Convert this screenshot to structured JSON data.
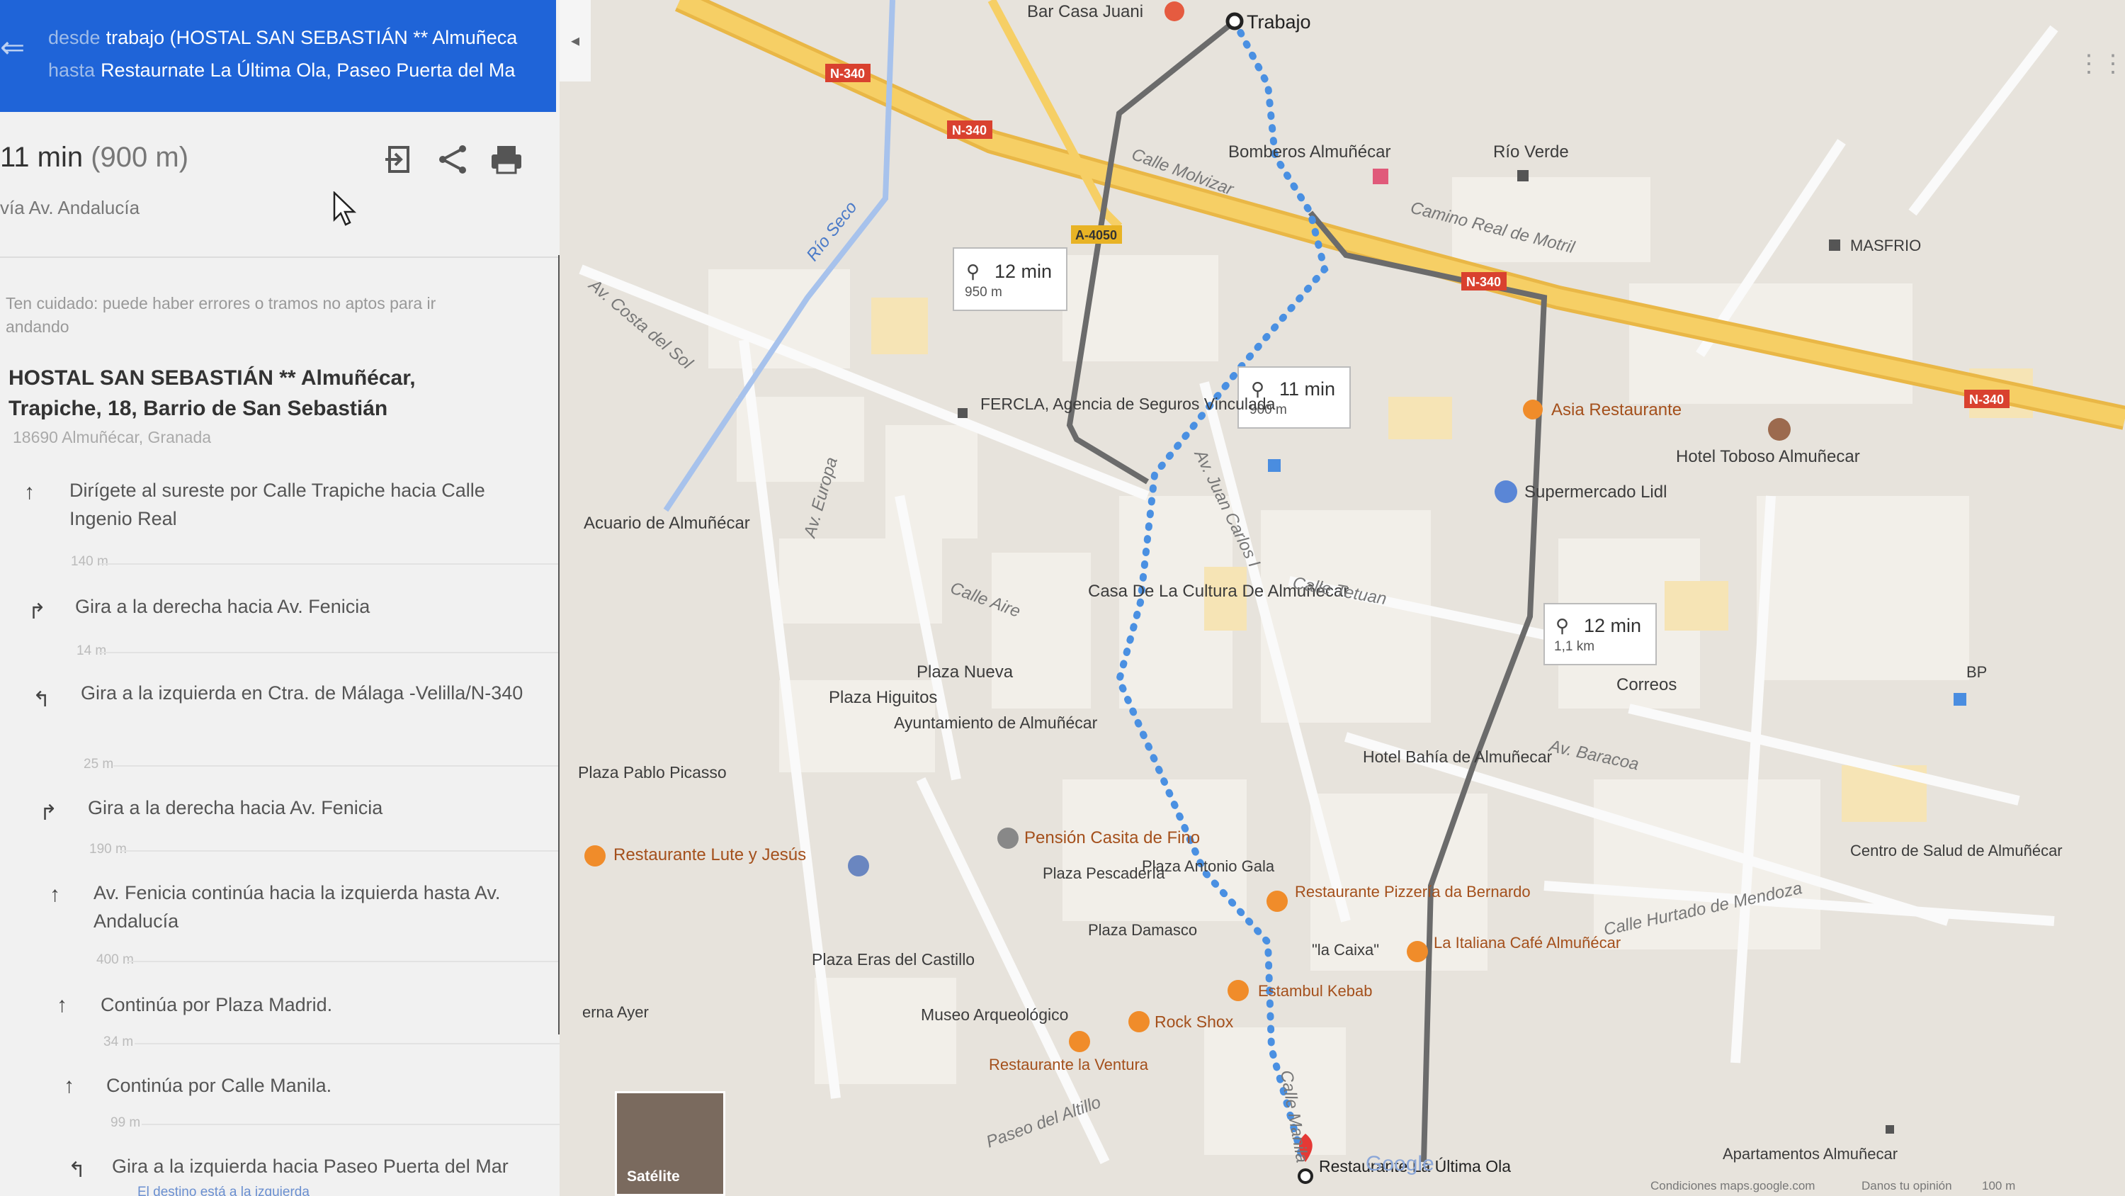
{
  "header": {
    "from_label": "desde",
    "from": "trabajo (HOSTAL SAN SEBASTIÁN ** Almuñeca",
    "to_label": "hasta",
    "to": "Restaurnate La Última Ola, Paseo Puerta del Ma"
  },
  "summary": {
    "time": "11 min",
    "distance": "(900 m)",
    "via": "vía Av. Andalucía"
  },
  "icons": {
    "back": "back-arrow-icon",
    "send": "send-to-device-icon",
    "share": "share-icon",
    "print": "print-icon"
  },
  "warning": "Ten cuidado: puede haber errores o tramos no aptos para ir andando",
  "origin": {
    "name": "HOSTAL SAN SEBASTIÁN ** Almuñécar, Trapiche, 18, Barrio de San Sebastián",
    "sub": "18690 Almuñécar, Granada"
  },
  "steps": [
    {
      "icon": "↑",
      "text": "Dirígete al sureste por Calle Trapiche hacia Calle Ingenio Real",
      "dist": "140 m"
    },
    {
      "icon": "↱",
      "text": "Gira a la derecha hacia Av. Fenicia",
      "dist": "14 m"
    },
    {
      "icon": "↰",
      "text": "Gira a la izquierda en Ctra. de Málaga -Velilla/N-340",
      "dist": "25 m"
    },
    {
      "icon": "↱",
      "text": "Gira a la derecha hacia Av. Fenicia",
      "dist": "190 m"
    },
    {
      "icon": "↑",
      "text": "Av. Fenicia continúa hacia la izquierda hasta Av. Andalucía",
      "dist": "400 m"
    },
    {
      "icon": "↑",
      "text": "Continúa por Plaza Madrid.",
      "dist": "34 m"
    },
    {
      "icon": "↑",
      "text": "Continúa por Calle Manila.",
      "dist": "99 m"
    },
    {
      "icon": "↰",
      "text": "Gira a la izquierda hacia Paseo Puerta del Mar",
      "dist": "El destino está a la izquierda"
    }
  ],
  "map": {
    "collapse": "◂",
    "route_boxes": [
      {
        "time": "12 min",
        "dist": "950 m"
      },
      {
        "time": "11 min",
        "dist": "900 m"
      },
      {
        "time": "12 min",
        "dist": "1,1 km"
      }
    ],
    "labels": {
      "trabajo": "Trabajo",
      "bar": "Bar Casa Juani",
      "bomberos": "Bomberos Almuñécar",
      "rio_verde": "Río Verde",
      "masfrio": "MASFRIO",
      "asia": "Asia Restaurante",
      "hotel_toboso": "Hotel Toboso Almuñecar",
      "lidl": "Supermercado Lidl",
      "fercla": "FERCLA, Agencia de Seguros Vinculada",
      "acuario": "Acuario de Almuñécar",
      "casa_cultura": "Casa De La Cultura De Almuñécar",
      "plaza_nueva": "Plaza Nueva",
      "plaza_higuitos": "Plaza Higuitos",
      "ayuntamiento": "Ayuntamiento de Almuñécar",
      "plaza_pablo": "Plaza Pablo Picasso",
      "correos": "Correos",
      "hotel_bahia": "Hotel Bahía de Almuñecar",
      "pension": "Pensión Casita de Fino",
      "lute": "Restaurante Lute y Jesús",
      "plaza_pescaderia": "Plaza Pescadería",
      "plaza_antonio": "Plaza Antonio Gala",
      "pizzeria": "Restaurante Pizzería da Bernardo",
      "plaza_damasco": "Plaza Damasco",
      "caixa": "\"la Caixa\"",
      "italiana": "La Italiana Café Almuñécar",
      "plaza_eras": "Plaza Eras del Castillo",
      "estambul": "Estambul Kebab",
      "museo": "Museo Arqueológico",
      "rock_shox": "Rock Shox",
      "ventura": "Restaurante la Ventura",
      "destino": "Restaurante La Última Ola",
      "centro_salud": "Centro de Salud de Almuñécar",
      "apartamentos": "Apartamentos Almuñecar",
      "rio_seco": "Río Seco",
      "n340": "N-340",
      "a4050": "A-4050",
      "bp": "BP",
      "av_costa": "Av. Costa del Sol",
      "calle_molvizar": "Calle Molvizar",
      "camino_real": "Camino Real de Motril",
      "av_juan_carlos": "Av. Juan Carlos I",
      "calle_tetuan": "Calle Tetuan",
      "av_baracoa": "Av. Baracoa",
      "calle_hurtado": "Calle Hurtado de Mendoza",
      "av_europa": "Av. Europa",
      "calle_aire": "Calle Aire",
      "calle_manila": "Calle Manila",
      "paseo_altillo": "Paseo del Altillo",
      "erna_ayer": "erna Ayer"
    },
    "satellite": "Satélite",
    "google": "Google",
    "footer_left": "Condiciones   maps.google.com",
    "footer_mid": "Danos tu opinión",
    "footer_scale": "100 m"
  },
  "colors": {
    "header_bg": "#1f64d8",
    "route_primary": "#4a90e2",
    "route_alt": "#777777",
    "highway": "#f6cf65"
  }
}
